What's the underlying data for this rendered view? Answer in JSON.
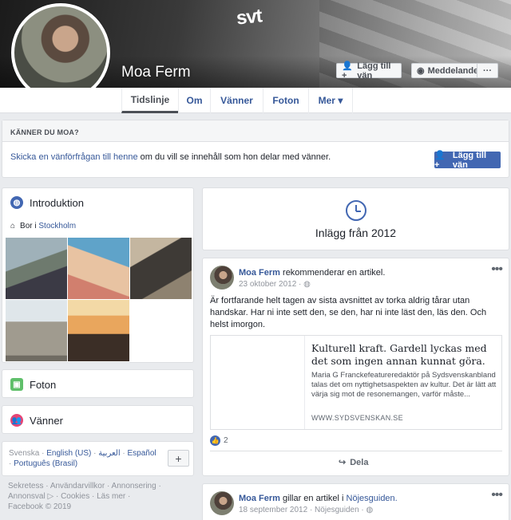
{
  "cover": {
    "logo_text": "svt"
  },
  "profile": {
    "name": "Moa Ferm"
  },
  "cover_buttons": {
    "add_friend": "Lägg till vän",
    "message": "Meddelande",
    "more": "···"
  },
  "nav": {
    "tabs": [
      "Tidslinje",
      "Om",
      "Vänner",
      "Foton",
      "Mer ▾"
    ]
  },
  "know_her": {
    "header": "KÄNNER DU MOA?",
    "link": "Skicka en vänförfrågan till henne",
    "text": " om du vill se innehåll som hon delar med vänner.",
    "button": "Lägg till vän"
  },
  "intro": {
    "title": "Introduktion",
    "lives_prefix": "Bor i ",
    "lives_city": "Stockholm"
  },
  "photos_card": {
    "title": "Foton"
  },
  "friends_card": {
    "title": "Vänner"
  },
  "languages": {
    "current": "Svenska",
    "options": [
      "English (US)",
      "العربية",
      "Español",
      "Português (Brasil)"
    ],
    "more": "+"
  },
  "footer": {
    "links": [
      "Sekretess",
      "Användarvillkor",
      "Annonsering",
      "Annonsval ▷",
      "Cookies",
      "Läs mer"
    ],
    "copyright": "Facebook © 2019"
  },
  "timeline_year": {
    "label": "Inlägg från 2012"
  },
  "post1": {
    "author": "Moa Ferm",
    "action": " rekommenderar en artikel.",
    "date": "23 oktober 2012",
    "text": "Är fortfarande helt tagen av sista avsnittet av torka aldrig tårar utan handskar. Har ni inte sett den, se den, har ni inte läst den, läs den. Och helst imorgon.",
    "article_title": "Kulturell kraft. Gardell lyckas med det som ingen annan kunnat göra.",
    "article_desc": "Maria G Franckefeatureredaktör på Sydsvenskanbland talas det om nyttighetsaspekten av kultur. Det är lätt att värja sig mot de resonemangen, varför måste...",
    "article_domain": "WWW.SYDSVENSKAN.SE",
    "likes": "2",
    "share": "Dela"
  },
  "post2": {
    "author": "Moa Ferm",
    "action": " gillar en artikel i ",
    "group": "Nöjesguiden.",
    "date": "18 september 2012",
    "meta": " · Nöjesguiden · "
  },
  "colors": {
    "brand": "#4267b2",
    "link": "#365899",
    "background": "#e9ebee"
  }
}
